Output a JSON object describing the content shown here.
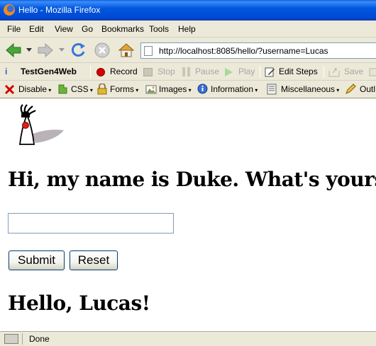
{
  "window": {
    "title": "Hello - Mozilla Firefox"
  },
  "menubar": {
    "items": [
      "File",
      "Edit",
      "View",
      "Go",
      "Bookmarks",
      "Tools",
      "Help"
    ]
  },
  "navbar": {
    "url": "http://localhost:8085/hello/?username=Lucas",
    "icons": [
      "back-arrow-icon",
      "forward-arrow-icon",
      "reload-icon",
      "stop-icon",
      "home-icon"
    ]
  },
  "testgen": {
    "title": "TestGen4Web",
    "record": "Record",
    "stop": "Stop",
    "pause": "Pause",
    "play": "Play",
    "edit_steps": "Edit Steps",
    "save": "Save"
  },
  "webdev": {
    "disable": "Disable",
    "css": "CSS",
    "forms": "Forms",
    "images": "Images",
    "information": "Information",
    "miscellaneous": "Miscellaneous",
    "outline": "Outl"
  },
  "page": {
    "heading": "Hi, my name is Duke. What's yours?",
    "name_value": "",
    "submit_label": "Submit",
    "reset_label": "Reset",
    "greeting": "Hello, Lucas!"
  },
  "status": {
    "text": "Done"
  },
  "colors": {
    "titlebar": "#0058e0",
    "record_red": "#d40000",
    "play_green": "#7ec36a",
    "chrome": "#ece9d8"
  }
}
